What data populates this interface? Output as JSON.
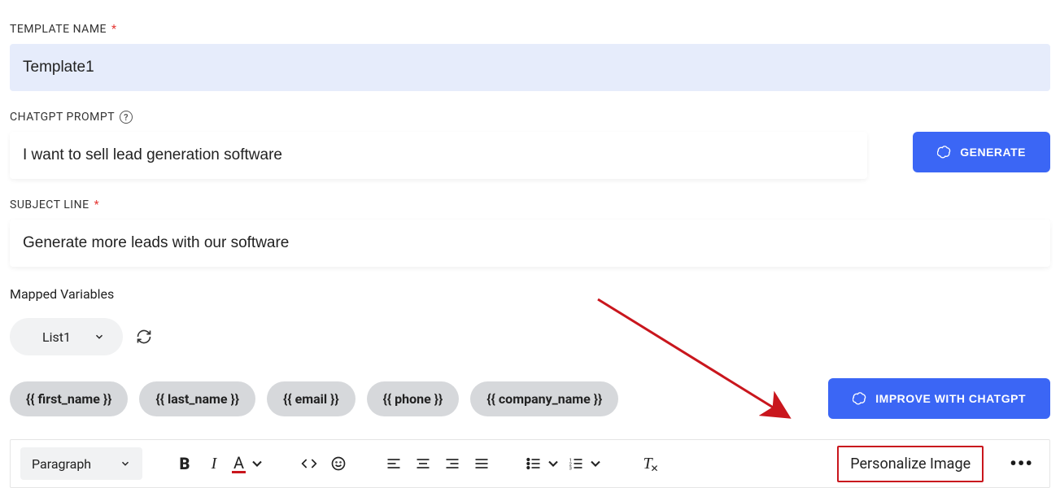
{
  "template_name": {
    "label": "TEMPLATE NAME",
    "value": "Template1"
  },
  "chatgpt_prompt": {
    "label": "CHATGPT PROMPT",
    "value": "I want to sell lead generation software"
  },
  "generate_button": "GENERATE",
  "subject_line": {
    "label": "SUBJECT LINE",
    "value": "Generate more leads with our software"
  },
  "mapped_variables": {
    "label": "Mapped Variables",
    "selected_list": "List1",
    "chips": [
      "{{ first_name }}",
      "{{ last_name }}",
      "{{ email }}",
      "{{ phone }}",
      "{{ company_name }}"
    ]
  },
  "improve_button": "IMPROVE WITH CHATGPT",
  "toolbar": {
    "block_format": "Paragraph",
    "personalize_label": "Personalize Image"
  }
}
